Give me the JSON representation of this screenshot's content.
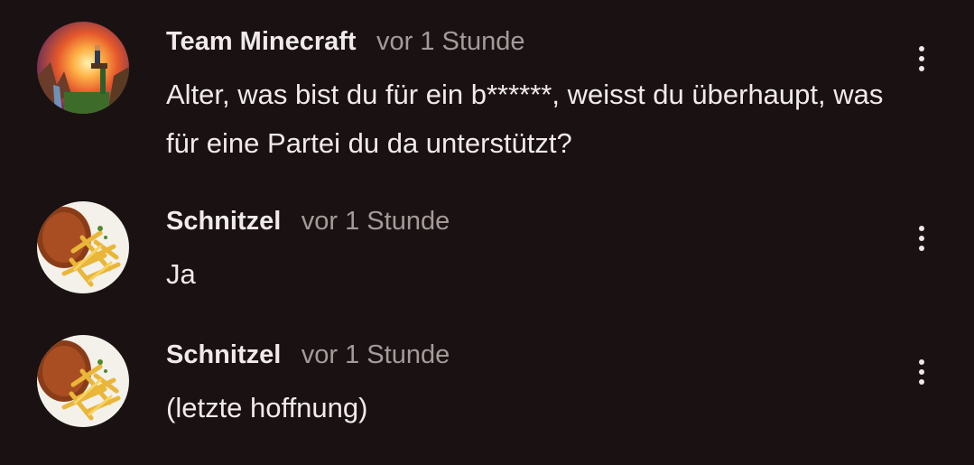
{
  "comments": [
    {
      "author": "Team Minecraft",
      "time": "vor 1 Stunde",
      "text": "Alter, was bist du für ein b******, weisst du überhaupt, was für eine Partei du da unterstützt?",
      "avatar_icon": "minecraft-sunset-avatar",
      "menu_icon": "more-vert-icon"
    },
    {
      "author": "Schnitzel",
      "time": "vor 1 Stunde",
      "text": "Ja",
      "avatar_icon": "schnitzel-fries-avatar",
      "menu_icon": "more-vert-icon"
    },
    {
      "author": "Schnitzel",
      "time": "vor 1 Stunde",
      "text": "(letzte hoffnung)",
      "avatar_icon": "schnitzel-fries-avatar",
      "menu_icon": "more-vert-icon"
    }
  ],
  "colors": {
    "background": "#1a1212",
    "primary_text": "#f1eaea",
    "secondary_text": "#a59a9a"
  }
}
